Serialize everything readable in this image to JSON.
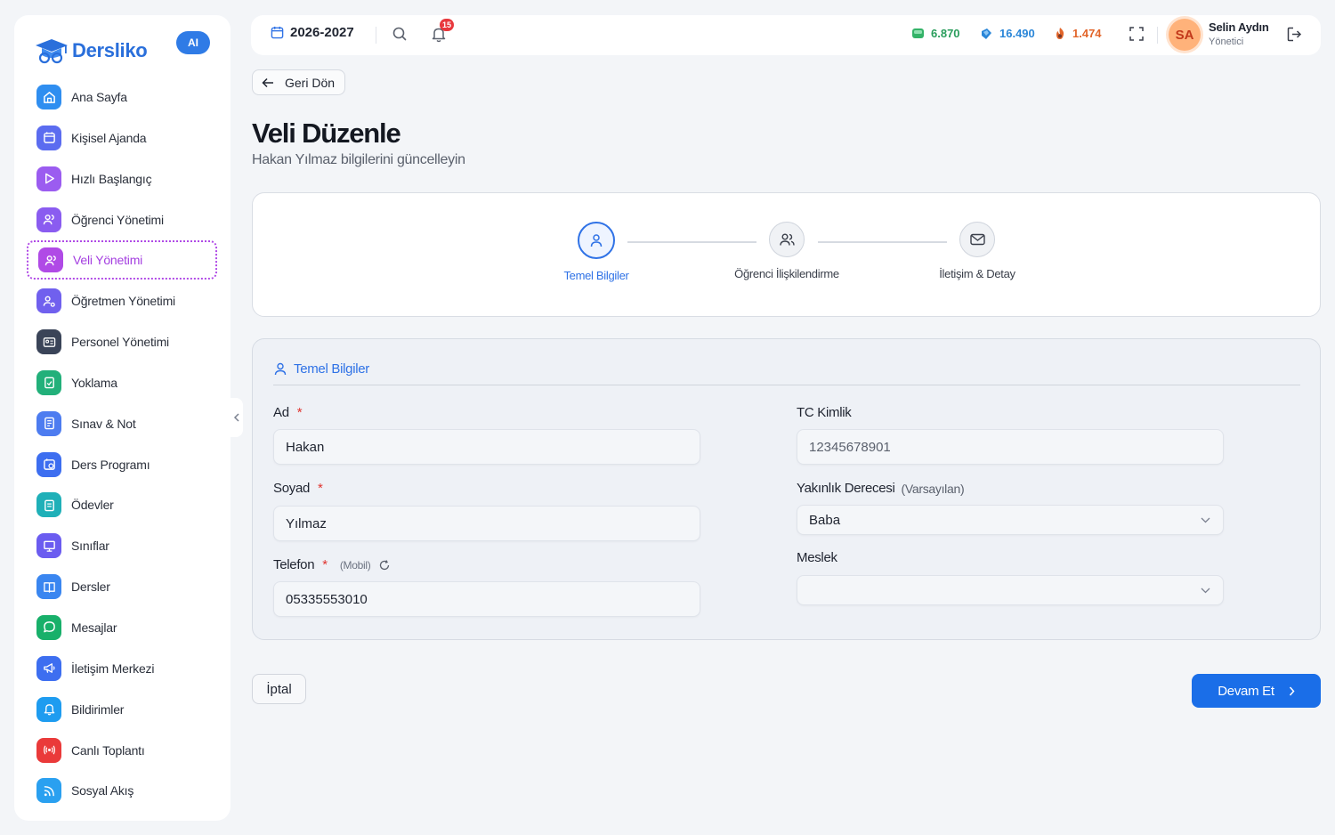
{
  "brand": {
    "name": "Dersliko",
    "ai_badge": "AI"
  },
  "sidebar": {
    "items": [
      {
        "label": "Ana Sayfa",
        "color": "#2f8ef0",
        "icon": "home-icon"
      },
      {
        "label": "Kişisel Ajanda",
        "color": "#5b6cf0",
        "icon": "calendar-icon"
      },
      {
        "label": "Hızlı Başlangıç",
        "color": "#9b5cf0",
        "icon": "play-icon"
      },
      {
        "label": "Öğrenci Yönetimi",
        "color": "#8a5cf0",
        "icon": "users-icon"
      },
      {
        "label": "Veli Yönetimi",
        "color": "#b04ae6",
        "icon": "parents-icon",
        "active": true
      },
      {
        "label": "Öğretmen Yönetimi",
        "color": "#7060ee",
        "icon": "teacher-icon"
      },
      {
        "label": "Personel Yönetimi",
        "color": "#3a4458",
        "icon": "id-card-icon"
      },
      {
        "label": "Yoklama",
        "color": "#22b07a",
        "icon": "clipboard-check-icon"
      },
      {
        "label": "Sınav & Not",
        "color": "#4d7cf0",
        "icon": "exam-icon"
      },
      {
        "label": "Ders Programı",
        "color": "#3d6ef0",
        "icon": "schedule-icon"
      },
      {
        "label": "Ödevler",
        "color": "#1fb0b8",
        "icon": "homework-icon"
      },
      {
        "label": "Sınıflar",
        "color": "#6b5cf0",
        "icon": "classroom-icon"
      },
      {
        "label": "Dersler",
        "color": "#3a86f0",
        "icon": "book-icon"
      },
      {
        "label": "Mesajlar",
        "color": "#18b06a",
        "icon": "message-icon"
      },
      {
        "label": "İletişim Merkezi",
        "color": "#3d6ef0",
        "icon": "megaphone-icon"
      },
      {
        "label": "Bildirimler",
        "color": "#1e9cf0",
        "icon": "bell-icon"
      },
      {
        "label": "Canlı Toplantı",
        "color": "#ea3a3a",
        "icon": "broadcast-icon"
      },
      {
        "label": "Sosyal Akış",
        "color": "#2aa0f0",
        "icon": "rss-icon"
      }
    ]
  },
  "header": {
    "year": "2026-2027",
    "notifications": "15",
    "stats": [
      {
        "value": "6.870",
        "color": "#2a9d5c",
        "icon": "green-gem-icon"
      },
      {
        "value": "16.490",
        "color": "#2a86d8",
        "icon": "blue-gem-icon"
      },
      {
        "value": "1.474",
        "color": "#e2652a",
        "icon": "fire-gem-icon"
      }
    ],
    "user": {
      "initials": "SA",
      "name": "Selin Aydın",
      "role": "Yönetici"
    }
  },
  "page": {
    "back_label": "Geri Dön",
    "title": "Veli Düzenle",
    "subtitle": "Hakan Yılmaz bilgilerini güncelleyin"
  },
  "steps": [
    {
      "label": "Temel Bilgiler",
      "active": true
    },
    {
      "label": "Öğrenci İlişkilendirme",
      "active": false
    },
    {
      "label": "İletişim & Detay",
      "active": false
    }
  ],
  "form": {
    "section_title": "Temel Bilgiler",
    "first_name": {
      "label": "Ad",
      "value": "Hakan",
      "required": "*"
    },
    "last_name": {
      "label": "Soyad",
      "value": "Yılmaz",
      "required": "*"
    },
    "phone": {
      "label": "Telefon",
      "hint": "(Mobil)",
      "value": "05335553010",
      "required": "*"
    },
    "tc": {
      "label": "TC Kimlik",
      "value": "12345678901"
    },
    "relation": {
      "label": "Yakınlık Derecesi",
      "hint": "(Varsayılan)",
      "value": "Baba"
    },
    "job": {
      "label": "Meslek",
      "value": ""
    }
  },
  "actions": {
    "cancel": "İptal",
    "continue": "Devam Et"
  }
}
